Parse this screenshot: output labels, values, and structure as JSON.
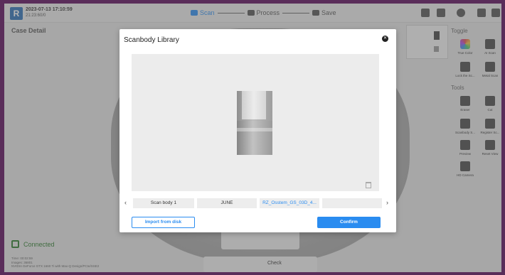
{
  "header": {
    "datetime": "2023-07-13 17:10:59",
    "case_id": "21:23:60/0",
    "steps": [
      {
        "label": "Scan",
        "active": true
      },
      {
        "label": "Process",
        "active": false
      },
      {
        "label": "Save",
        "active": false
      }
    ]
  },
  "left": {
    "case_detail": "Case Detail",
    "status": "Connected",
    "info_lines": [
      "Time: 00:02:59",
      "Images: 36801",
      "NVIDIA GeForce GTX 1660 Ti with Max-Q Design/PCIe/SSE2"
    ]
  },
  "right_panel": {
    "toggle_title": "Toggle",
    "toggle_items": [
      {
        "label": "True Color",
        "icon": "true-color-icon"
      },
      {
        "label": "AI Scan",
        "icon": "ai-scan-icon"
      },
      {
        "label": "Lock the Sc...",
        "icon": "lock-scan-icon"
      },
      {
        "label": "Metal Scan",
        "icon": "metal-scan-icon"
      }
    ],
    "tools_title": "Tools",
    "tool_items": [
      {
        "label": "Eraser",
        "icon": "eraser-icon"
      },
      {
        "label": "Cut",
        "icon": "cut-icon"
      },
      {
        "label": "Scanbody S...",
        "icon": "scanbody-icon"
      },
      {
        "label": "Register Sc...",
        "icon": "register-scan-icon"
      },
      {
        "label": "Preview",
        "icon": "preview-icon"
      },
      {
        "label": "Reset View",
        "icon": "reset-view-icon"
      },
      {
        "label": "HD Camera",
        "icon": "hd-camera-icon"
      }
    ]
  },
  "bottom": {
    "check_label": "Check"
  },
  "modal": {
    "title": "Scanbody Library",
    "library_items": [
      {
        "label": "Scan body 1",
        "selected": false
      },
      {
        "label": "JUNE",
        "selected": false
      },
      {
        "label": "RZ_Osstem_GS_03D_4...",
        "selected": true
      },
      {
        "label": "",
        "selected": false
      }
    ],
    "import_label": "Import from disk",
    "confirm_label": "Confirm"
  },
  "colors": {
    "accent": "#2a8cf0",
    "connected": "#2a7a2a",
    "frame": "#5a2d5a"
  }
}
